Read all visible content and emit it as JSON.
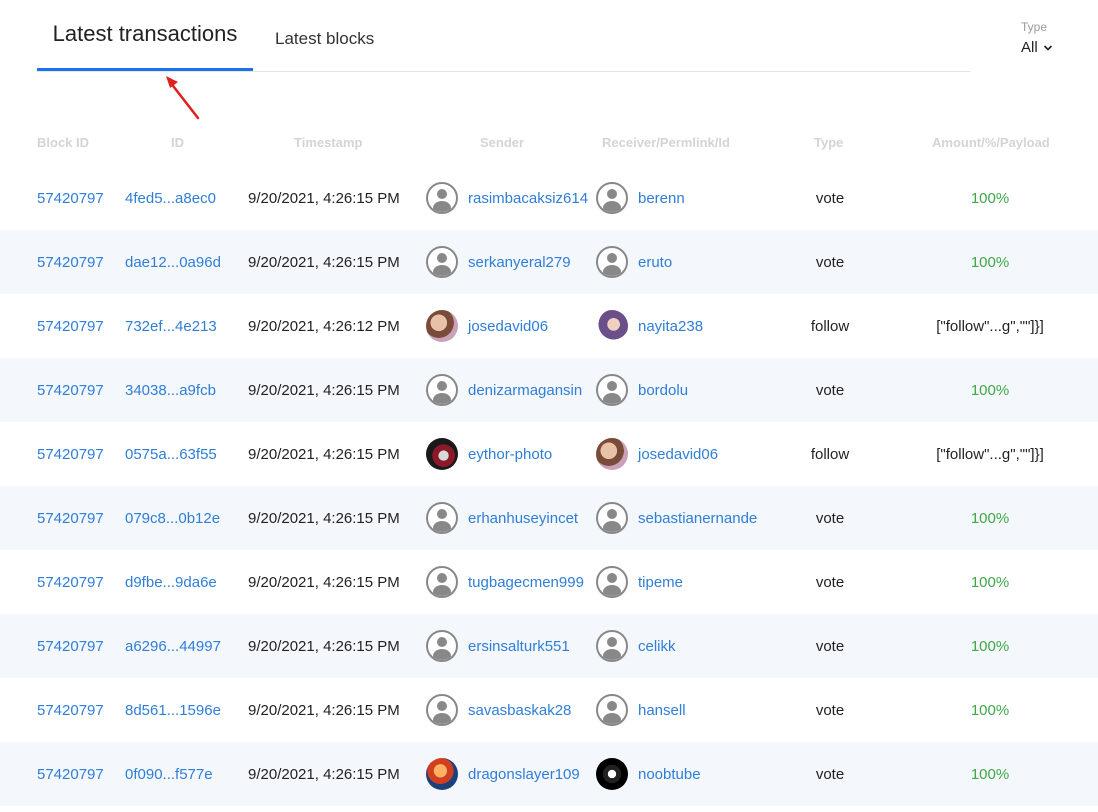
{
  "tabs": [
    {
      "label": "Latest transactions",
      "active": true
    },
    {
      "label": "Latest blocks",
      "active": false
    }
  ],
  "filter": {
    "label": "Type",
    "value": "All"
  },
  "columns": [
    "Block ID",
    "ID",
    "Timestamp",
    "Sender",
    "Receiver/Permlink/Id",
    "Type",
    "Amount/%/Payload"
  ],
  "colors": {
    "accent": "#1a73e8",
    "link": "#2f7ed8",
    "positive": "#3fa74a",
    "annotation_arrow": "#e0201c"
  },
  "rows": [
    {
      "block_id": "57420797",
      "id": "4fed5...a8ec0",
      "timestamp": "9/20/2021, 4:26:15 PM",
      "sender": "rasimbacaksiz614",
      "sender_avatar": "default-avatar-icon",
      "receiver": "berenn",
      "receiver_avatar": "default-avatar-icon",
      "type": "vote",
      "amount": "100%",
      "amount_kind": "percent"
    },
    {
      "block_id": "57420797",
      "id": "dae12...0a96d",
      "timestamp": "9/20/2021, 4:26:15 PM",
      "sender": "serkanyeral279",
      "sender_avatar": "default-avatar-icon",
      "receiver": "eruto",
      "receiver_avatar": "default-avatar-icon",
      "type": "vote",
      "amount": "100%",
      "amount_kind": "percent"
    },
    {
      "block_id": "57420797",
      "id": "732ef...4e213",
      "timestamp": "9/20/2021, 4:26:12 PM",
      "sender": "josedavid06",
      "sender_avatar": "photo-a",
      "receiver": "nayita238",
      "receiver_avatar": "photo-b",
      "type": "follow",
      "amount": "[\"follow\"...g\",\"\"]}]",
      "amount_kind": "payload"
    },
    {
      "block_id": "57420797",
      "id": "34038...a9fcb",
      "timestamp": "9/20/2021, 4:26:15 PM",
      "sender": "denizarmagansin",
      "sender_avatar": "default-avatar-icon",
      "receiver": "bordolu",
      "receiver_avatar": "default-avatar-icon",
      "type": "vote",
      "amount": "100%",
      "amount_kind": "percent"
    },
    {
      "block_id": "57420797",
      "id": "0575a...63f55",
      "timestamp": "9/20/2021, 4:26:15 PM",
      "sender": "eythor-photo",
      "sender_avatar": "photo-c",
      "receiver": "josedavid06",
      "receiver_avatar": "photo-a",
      "type": "follow",
      "amount": "[\"follow\"...g\",\"\"]}]",
      "amount_kind": "payload"
    },
    {
      "block_id": "57420797",
      "id": "079c8...0b12e",
      "timestamp": "9/20/2021, 4:26:15 PM",
      "sender": "erhanhuseyincet",
      "sender_avatar": "default-avatar-icon",
      "receiver": "sebastianernande",
      "receiver_avatar": "default-avatar-icon",
      "type": "vote",
      "amount": "100%",
      "amount_kind": "percent"
    },
    {
      "block_id": "57420797",
      "id": "d9fbe...9da6e",
      "timestamp": "9/20/2021, 4:26:15 PM",
      "sender": "tugbagecmen999",
      "sender_avatar": "default-avatar-icon",
      "receiver": "tipeme",
      "receiver_avatar": "default-avatar-icon",
      "type": "vote",
      "amount": "100%",
      "amount_kind": "percent"
    },
    {
      "block_id": "57420797",
      "id": "a6296...44997",
      "timestamp": "9/20/2021, 4:26:15 PM",
      "sender": "ersinsalturk551",
      "sender_avatar": "default-avatar-icon",
      "receiver": "celikk",
      "receiver_avatar": "default-avatar-icon",
      "type": "vote",
      "amount": "100%",
      "amount_kind": "percent"
    },
    {
      "block_id": "57420797",
      "id": "8d561...1596e",
      "timestamp": "9/20/2021, 4:26:15 PM",
      "sender": "savasbaskak28",
      "sender_avatar": "default-avatar-icon",
      "receiver": "hansell",
      "receiver_avatar": "default-avatar-icon",
      "type": "vote",
      "amount": "100%",
      "amount_kind": "percent"
    },
    {
      "block_id": "57420797",
      "id": "0f090...f577e",
      "timestamp": "9/20/2021, 4:26:15 PM",
      "sender": "dragonslayer109",
      "sender_avatar": "photo-d",
      "receiver": "noobtube",
      "receiver_avatar": "photo-e",
      "type": "vote",
      "amount": "100%",
      "amount_kind": "percent"
    }
  ]
}
